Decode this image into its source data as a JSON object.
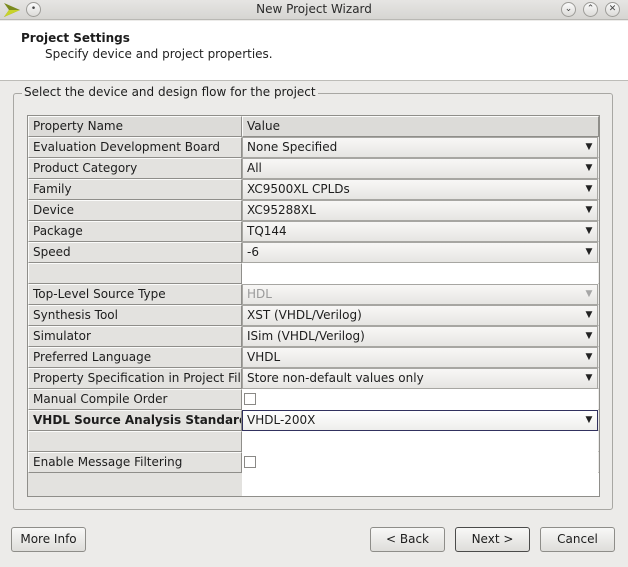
{
  "window": {
    "title": "New Project Wizard"
  },
  "header": {
    "title": "Project Settings",
    "subtitle": "Specify device and project properties."
  },
  "group": {
    "legend": "Select the device and design flow for the project"
  },
  "table": {
    "col_name": "Property Name",
    "col_value": "Value",
    "rows": [
      {
        "name": "Evaluation Development Board",
        "value": "None Specified"
      },
      {
        "name": "Product Category",
        "value": "All"
      },
      {
        "name": "Family",
        "value": "XC9500XL CPLDs"
      },
      {
        "name": "Device",
        "value": "XC95288XL"
      },
      {
        "name": "Package",
        "value": "TQ144"
      },
      {
        "name": "Speed",
        "value": "-6"
      },
      {
        "name": "",
        "value": ""
      },
      {
        "name": "Top-Level Source Type",
        "value": "HDL"
      },
      {
        "name": "Synthesis Tool",
        "value": "XST (VHDL/Verilog)"
      },
      {
        "name": "Simulator",
        "value": "ISim (VHDL/Verilog)"
      },
      {
        "name": "Preferred Language",
        "value": "VHDL"
      },
      {
        "name": "Property Specification in Project File",
        "value": "Store non-default values only"
      },
      {
        "name": "Manual Compile Order",
        "value": ""
      },
      {
        "name": "VHDL Source Analysis Standard",
        "value": "VHDL-200X"
      },
      {
        "name": "",
        "value": ""
      },
      {
        "name": "Enable Message Filtering",
        "value": ""
      }
    ]
  },
  "buttons": {
    "more_info": "More Info",
    "back": "< Back",
    "next": "Next >",
    "cancel": "Cancel"
  }
}
